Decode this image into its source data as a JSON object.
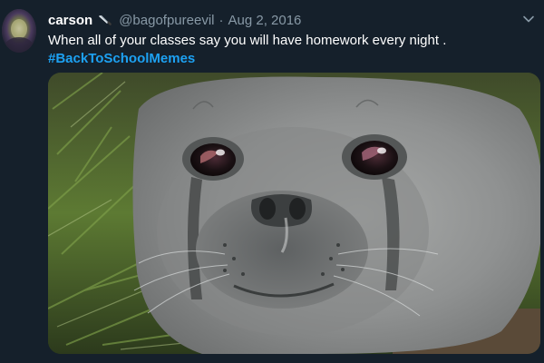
{
  "tweet": {
    "display_name": "carson",
    "name_emoji_icon": "knife-icon",
    "handle": "@bagofpureevil",
    "separator": "·",
    "date": "Aug 2, 2016",
    "text_line": "When all of your classes say you will have homework every night .",
    "hashtag": "#BackToSchoolMemes",
    "menu_icon": "chevron-down-icon",
    "media_icon": "crying-seal-photo"
  },
  "colors": {
    "background": "#15202b",
    "text": "#ffffff",
    "muted": "#8899a6",
    "link": "#1da1f2"
  }
}
